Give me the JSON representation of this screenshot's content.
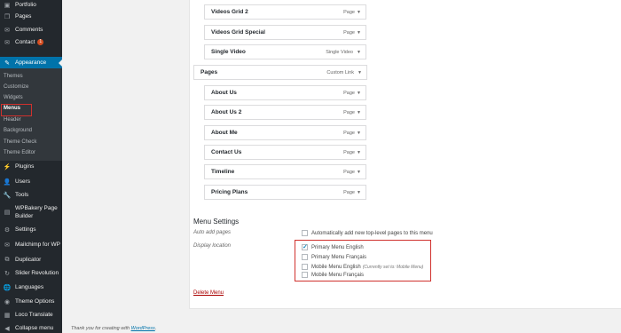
{
  "sidebar": {
    "items": [
      {
        "label": "Portfolio",
        "icon": "portfolio-icon",
        "glyph": "▣"
      },
      {
        "label": "Pages",
        "icon": "pages-icon",
        "glyph": "❐"
      },
      {
        "label": "Comments",
        "icon": "comments-icon",
        "glyph": "✉"
      },
      {
        "label": "Contact",
        "icon": "contact-icon",
        "glyph": "✉",
        "badge": "1"
      },
      {
        "label": "Appearance",
        "icon": "appearance-icon",
        "glyph": "✎",
        "active": true
      },
      {
        "label": "Plugins",
        "icon": "plugins-icon",
        "glyph": "⚡"
      },
      {
        "label": "Users",
        "icon": "users-icon",
        "glyph": "👤"
      },
      {
        "label": "Tools",
        "icon": "tools-icon",
        "glyph": "🔧"
      },
      {
        "label": "WPBakery Page",
        "label2": "Builder",
        "icon": "wpbakery-icon",
        "glyph": "▤"
      },
      {
        "label": "Settings",
        "icon": "settings-icon",
        "glyph": "⚙"
      },
      {
        "label": "Mailchimp for WP",
        "icon": "mailchimp-icon",
        "glyph": "✉"
      },
      {
        "label": "Duplicator",
        "icon": "duplicator-icon",
        "glyph": "⧉"
      },
      {
        "label": "Slider Revolution",
        "icon": "slider-revolution-icon",
        "glyph": "↻"
      },
      {
        "label": "Languages",
        "icon": "languages-icon",
        "glyph": "🌐"
      },
      {
        "label": "Theme Options",
        "icon": "theme-options-icon",
        "glyph": "◉"
      },
      {
        "label": "Loco Translate",
        "icon": "loco-translate-icon",
        "glyph": "▦"
      },
      {
        "label": "Collapse menu",
        "icon": "collapse-menu-icon",
        "glyph": "◀"
      }
    ],
    "submenu": [
      "Themes",
      "Customize",
      "Widgets",
      "Menus",
      "Header",
      "Background",
      "Theme Check",
      "Theme Editor"
    ],
    "current_submenu": "Menus"
  },
  "menu_items": [
    {
      "title": "Videos Grid 2",
      "type": "Page"
    },
    {
      "title": "Videos Grid Special",
      "type": "Page"
    },
    {
      "title": "Single Video",
      "type": "Single Video"
    },
    {
      "title": "Pages",
      "type": "Custom Link"
    },
    {
      "title": "About Us",
      "type": "Page"
    },
    {
      "title": "About Us 2",
      "type": "Page"
    },
    {
      "title": "About Me",
      "type": "Page"
    },
    {
      "title": "Contact Us",
      "type": "Page"
    },
    {
      "title": "Timeline",
      "type": "Page"
    },
    {
      "title": "Pricing Plans",
      "type": "Page"
    }
  ],
  "menu_settings": {
    "heading": "Menu Settings",
    "auto_add_label": "Auto add pages",
    "auto_add_text": "Automatically add new top-level pages to this menu",
    "display_location_label": "Display location",
    "locations": [
      {
        "label": "Primary Menu English",
        "checked": true
      },
      {
        "label": "Primary Menu Français",
        "checked": false
      },
      {
        "label": "Mobile Menu English",
        "note": "(Currently set to: Mobile Menu)",
        "checked": false
      },
      {
        "label": "Mobile Menu Français",
        "checked": false
      }
    ]
  },
  "delete_menu": "Delete Menu",
  "footer": {
    "text": "Thank you for creating with",
    "link": "WordPress",
    "end": "."
  },
  "colors": {
    "sidebar": "#23282d",
    "accent": "#0073aa",
    "highlight": "#d0312d"
  }
}
